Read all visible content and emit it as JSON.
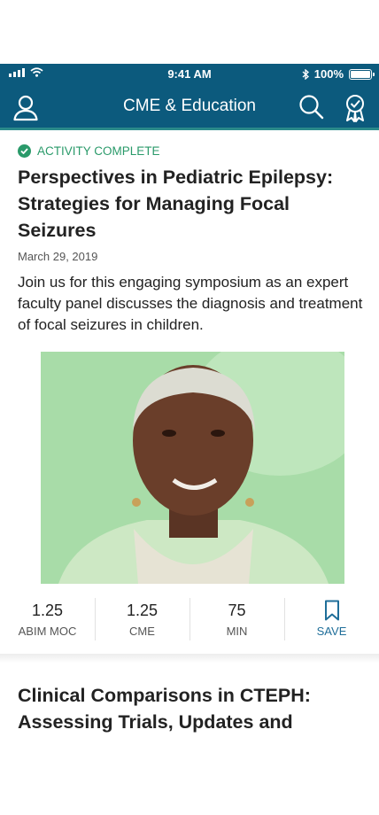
{
  "status_bar": {
    "time": "9:41 AM",
    "battery": "100%"
  },
  "header": {
    "title": "CME & Education"
  },
  "icons": {
    "profile": "person-icon",
    "search": "search-icon",
    "achievements": "award-ribbon-icon",
    "complete": "check-circle-icon",
    "save": "bookmark-icon"
  },
  "colors": {
    "header_bg": "#0c5a7d",
    "accent_green": "#2a9a6a",
    "link_blue": "#1f6e99"
  },
  "activity": {
    "status": "ACTIVITY COMPLETE",
    "title": "Perspectives in Pediatric Epilepsy: Strategies for Managing Focal Seizures",
    "date": "March 29, 2019",
    "description": "Join us for this engaging symposium as an expert faculty panel discusses the diagnosis and treatment of focal seizures in children.",
    "stats": [
      {
        "value": "1.25",
        "label": "ABIM MOC"
      },
      {
        "value": "1.25",
        "label": "CME"
      },
      {
        "value": "75",
        "label": "MIN"
      }
    ],
    "save_label": "SAVE"
  },
  "next_activity": {
    "title": "Clinical Comparisons in CTEPH: Assessing Trials, Updates and"
  }
}
